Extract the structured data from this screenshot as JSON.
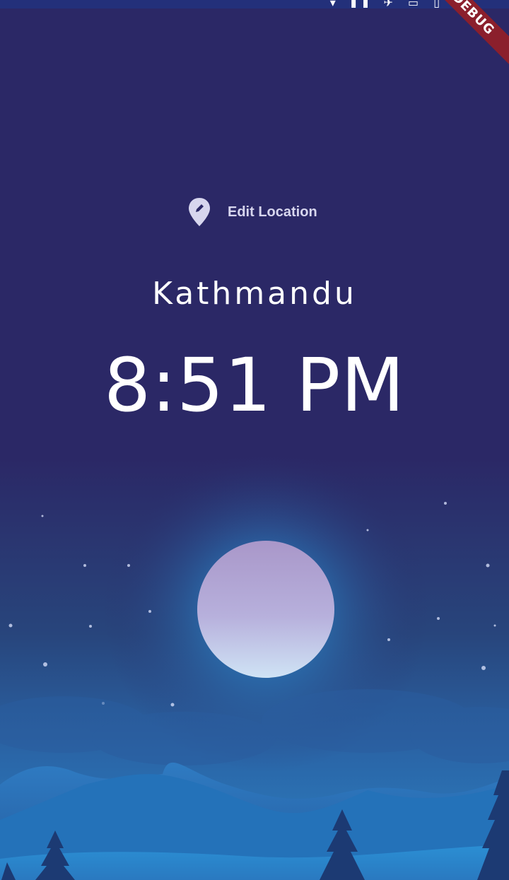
{
  "status_bar": {
    "icons_text": "▾ ▮▮ ✈ ▭ ▯"
  },
  "debug_banner": {
    "label": "DEBUG",
    "color": "#8b1f2c"
  },
  "location": {
    "edit_button_label": "Edit Location",
    "icon": "edit-location-pin-icon",
    "city": "Kathmandu",
    "time": "8:51 PM"
  },
  "theme": {
    "background": "#2b2866",
    "moon": "#c9c3e3",
    "hills": "#2c84c8"
  }
}
